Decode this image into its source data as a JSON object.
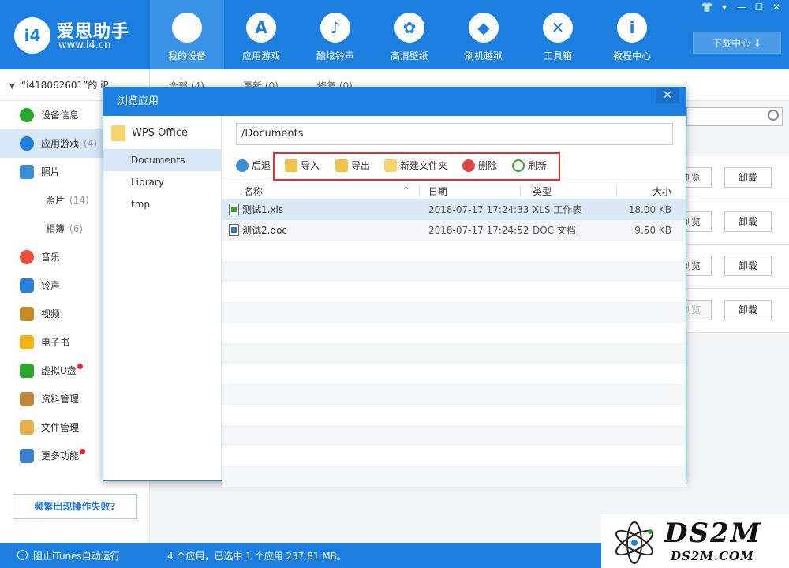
{
  "app": {
    "logo_badge": "i4",
    "logo_title": "爱思助手",
    "logo_url": "www.i4.cn",
    "download_center": "下载中心 ⬇"
  },
  "nav": [
    {
      "label": "我的设备",
      "icon": "apple-icon",
      "glyph": ""
    },
    {
      "label": "应用游戏",
      "icon": "appstore-icon",
      "glyph": "A"
    },
    {
      "label": "酷炫铃声",
      "icon": "bell-icon",
      "glyph": "♪"
    },
    {
      "label": "高清壁纸",
      "icon": "flower-icon",
      "glyph": "✿"
    },
    {
      "label": "刷机越狱",
      "icon": "dropbox-icon",
      "glyph": "◆"
    },
    {
      "label": "工具箱",
      "icon": "tools-icon",
      "glyph": "✕"
    },
    {
      "label": "教程中心",
      "icon": "info-icon",
      "glyph": "i"
    }
  ],
  "window_controls": [
    "👕",
    "▾",
    "—",
    "☐",
    "✕"
  ],
  "sidebar": {
    "device": "“i418062601”的 iP",
    "items": [
      {
        "label": "设备信息",
        "count": "",
        "icon": "info-icon",
        "color": "#2aa72a",
        "kind": "round"
      },
      {
        "label": "应用游戏",
        "count": "(4)",
        "icon": "appstore-icon",
        "color": "#1c7fe0",
        "kind": "round"
      },
      {
        "label": "照片",
        "count": "",
        "icon": "photo-icon",
        "color": "#3a8fd8",
        "kind": "square"
      },
      {
        "label": "照片",
        "count": "(14)",
        "icon": "",
        "color": "",
        "kind": "sub"
      },
      {
        "label": "相簿",
        "count": "(6)",
        "icon": "",
        "color": "",
        "kind": "sub"
      },
      {
        "label": "音乐",
        "count": "",
        "icon": "music-icon",
        "color": "#e8503b",
        "kind": "round"
      },
      {
        "label": "铃声",
        "count": "",
        "icon": "bell-icon",
        "color": "#2b7fe0",
        "kind": "square"
      },
      {
        "label": "视频",
        "count": "",
        "icon": "film-icon",
        "color": "#c58a2a",
        "kind": "square"
      },
      {
        "label": "电子书",
        "count": "",
        "icon": "book-icon",
        "color": "#f2b21a",
        "kind": "square"
      },
      {
        "label": "虚拟U盘",
        "count": "",
        "icon": "usb-icon",
        "color": "#2aa72a",
        "kind": "square",
        "dot": true
      },
      {
        "label": "资料管理",
        "count": "",
        "icon": "contacts-icon",
        "color": "#c0863a",
        "kind": "square"
      },
      {
        "label": "文件管理",
        "count": "",
        "icon": "file-icon",
        "color": "#e4b04a",
        "kind": "square"
      },
      {
        "label": "更多功能",
        "count": "",
        "icon": "grid-icon",
        "color": "#3a7fd0",
        "kind": "square",
        "dot": true
      }
    ],
    "fail_button": "频繁出现操作失败?"
  },
  "main": {
    "tabs": [
      "全部 (4)",
      "更新 (0)",
      "修复 (0)"
    ],
    "rows": [
      {
        "preview": "浏览",
        "uninstall": "卸载",
        "disabled": false
      },
      {
        "preview": "浏览",
        "uninstall": "卸载",
        "disabled": false
      },
      {
        "preview": "浏览",
        "uninstall": "卸载",
        "disabled": false
      },
      {
        "preview": "浏览",
        "uninstall": "卸载",
        "disabled": true
      }
    ]
  },
  "status": {
    "itunes": "阻止iTunes自动运行",
    "summary": "4 个应用，已选中 1 个应用 237.81 MB。"
  },
  "watermark": {
    "big": "DS2M",
    "small": "DS2M.COM"
  },
  "dialog": {
    "title": "浏览应用",
    "close": "✕",
    "root_folder": "WPS Office",
    "folders": [
      "Documents",
      "Library",
      "tmp"
    ],
    "active_folder": 0,
    "path": "/Documents",
    "toolbar": {
      "back": "后退",
      "import": "导入",
      "export": "导出",
      "new_folder": "新建文件夹",
      "delete": "删除",
      "refresh": "刷新"
    },
    "columns": {
      "name": "名称",
      "date": "日期",
      "type": "类型",
      "size": "大小"
    },
    "files": [
      {
        "name": "测试1.xls",
        "date": "2018-07-17 17:24:33",
        "type": "XLS 工作表",
        "size": "18.00 KB",
        "kind": "xls",
        "selected": true
      },
      {
        "name": "测试2.doc",
        "date": "2018-07-17 17:24:52",
        "type": "DOC 文档",
        "size": "9.50 KB",
        "kind": "doc",
        "selected": false
      }
    ]
  }
}
